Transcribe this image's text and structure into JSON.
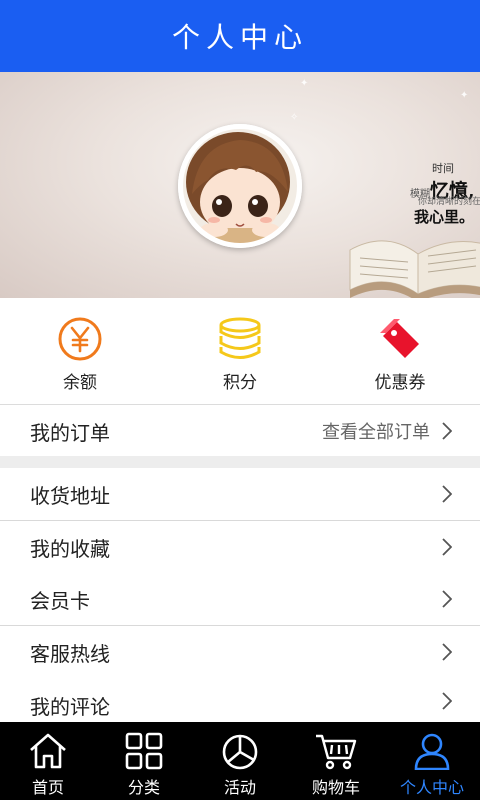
{
  "header": {
    "title": "个人中心"
  },
  "banner": {
    "text_line1": "时间",
    "text_line2_small": "模糊",
    "text_line2_big": "忆憶,",
    "text_line3": "你却清晰的刻在",
    "text_line4": "我心里。"
  },
  "quick": [
    {
      "label": "余额",
      "icon": "yen-circle-icon",
      "color": "#f07a1c"
    },
    {
      "label": "积分",
      "icon": "coin-stack-icon",
      "color": "#f5c81a"
    },
    {
      "label": "优惠券",
      "icon": "coupon-tag-icon",
      "color": "#e8132c"
    }
  ],
  "orders": {
    "label": "我的订单",
    "extra": "查看全部订单"
  },
  "menu": [
    {
      "label": "收货地址"
    },
    {
      "label": "我的收藏"
    },
    {
      "label": "会员卡"
    },
    {
      "label": "客服热线"
    },
    {
      "label": "我的评论"
    }
  ],
  "tabs": [
    {
      "label": "首页",
      "icon": "home-icon"
    },
    {
      "label": "分类",
      "icon": "grid-icon"
    },
    {
      "label": "活动",
      "icon": "pie-chart-icon"
    },
    {
      "label": "购物车",
      "icon": "cart-icon"
    },
    {
      "label": "个人中心",
      "icon": "user-icon",
      "active": true
    }
  ],
  "colors": {
    "header": "#1a5ef2",
    "tab_active": "#2f86ff",
    "tabbar": "#000000"
  }
}
